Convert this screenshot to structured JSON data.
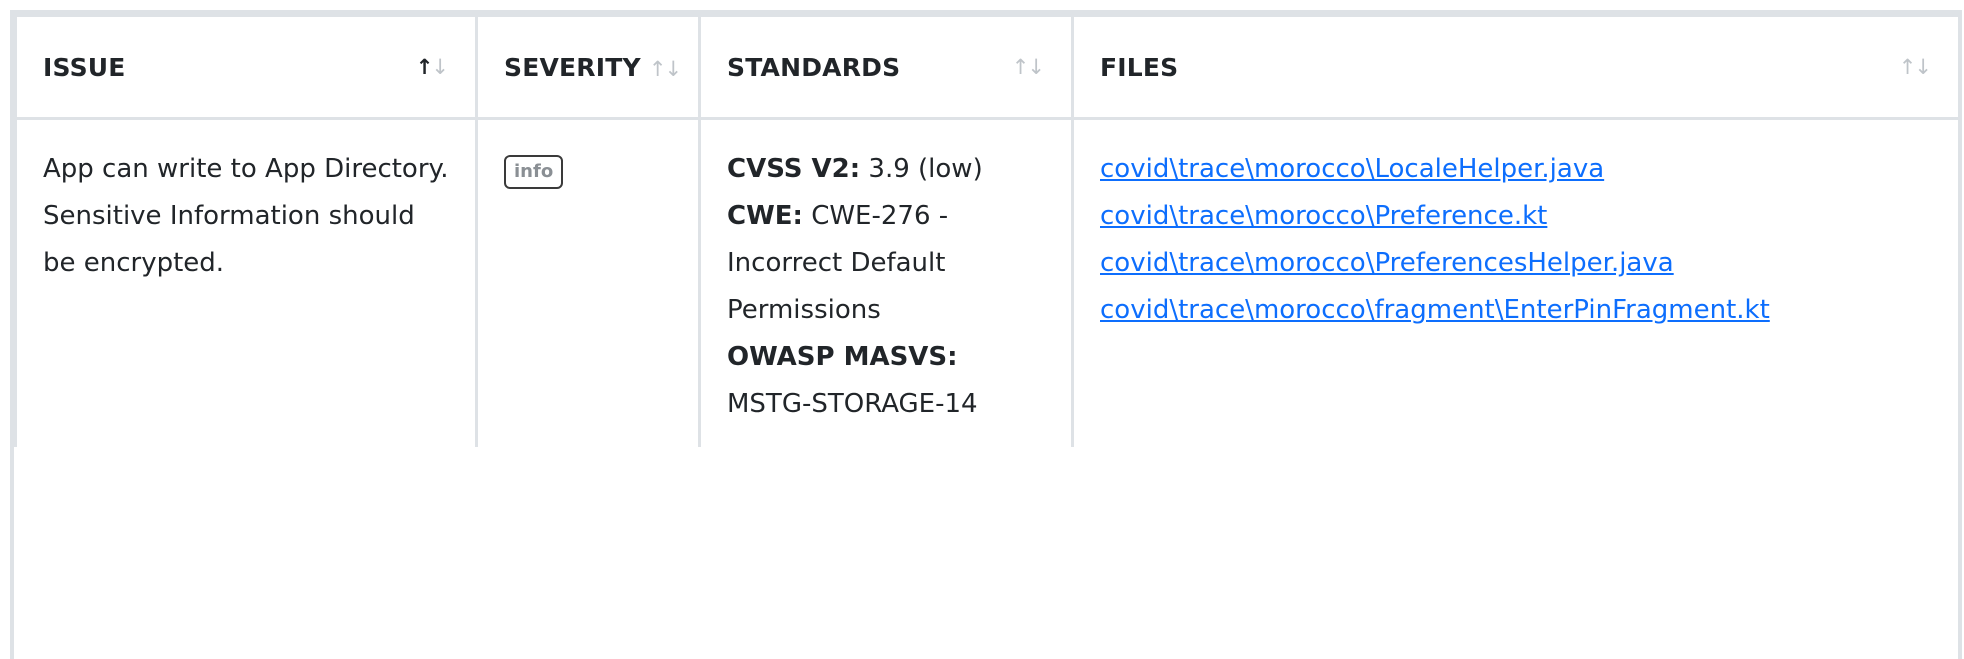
{
  "table": {
    "headers": {
      "issue": "ISSUE",
      "severity": "SEVERITY",
      "standards": "STANDARDS",
      "files": "FILES"
    },
    "sort_glyphs": {
      "up": "↑",
      "down": "↓"
    },
    "rows": [
      {
        "issue": "App can write to App Directory. Sensitive Information should be encrypted.",
        "severity": "info",
        "standards": {
          "cvss_label": "CVSS V2:",
          "cvss_value": "3.9 (low)",
          "cwe_label": "CWE:",
          "cwe_value": "CWE-276 - Incorrect Default Permissions",
          "owasp_label": "OWASP MASVS:",
          "owasp_value": "MSTG-STORAGE-14"
        },
        "files": [
          "covid\\trace\\morocco\\LocaleHelper.java",
          "covid\\trace\\morocco\\Preference.kt",
          "covid\\trace\\morocco\\PreferencesHelper.java",
          "covid\\trace\\morocco\\fragment\\EnterPinFragment.kt"
        ]
      }
    ]
  },
  "colors": {
    "border": "#dee2e6",
    "link": "#0d6efd",
    "text": "#212529",
    "badge_text": "#8a8f94"
  }
}
